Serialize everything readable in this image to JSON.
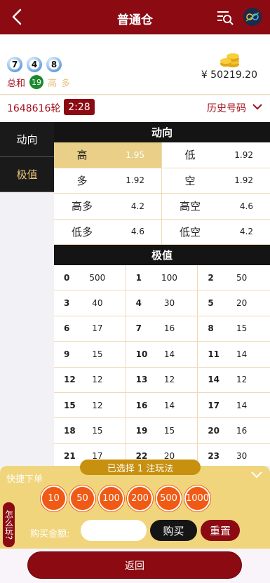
{
  "header": {
    "title": "普通仓"
  },
  "draw": {
    "balls": [
      "7",
      "4",
      "8"
    ],
    "sum_label": "总和",
    "sum_value": "19",
    "tags": [
      "高",
      "多"
    ]
  },
  "account": {
    "balance": "¥ 50219.20"
  },
  "round": {
    "label": "1648616轮",
    "timer": "2:28",
    "history_label": "历史号码"
  },
  "sidenav": {
    "items": [
      {
        "label": "动向"
      },
      {
        "label": "极值"
      }
    ]
  },
  "trend": {
    "title": "动向",
    "options": [
      {
        "name": "高",
        "odds": "1.95"
      },
      {
        "name": "低",
        "odds": "1.92"
      },
      {
        "name": "多",
        "odds": "1.92"
      },
      {
        "name": "空",
        "odds": "1.92"
      },
      {
        "name": "高多",
        "odds": "4.2"
      },
      {
        "name": "高空",
        "odds": "4.6"
      },
      {
        "name": "低多",
        "odds": "4.6"
      },
      {
        "name": "低空",
        "odds": "4.2"
      }
    ]
  },
  "extreme": {
    "title": "极值",
    "numbers": [
      {
        "n": "0",
        "v": "500"
      },
      {
        "n": "1",
        "v": "100"
      },
      {
        "n": "2",
        "v": "50"
      },
      {
        "n": "3",
        "v": "40"
      },
      {
        "n": "4",
        "v": "30"
      },
      {
        "n": "5",
        "v": "20"
      },
      {
        "n": "6",
        "v": "17"
      },
      {
        "n": "7",
        "v": "16"
      },
      {
        "n": "8",
        "v": "15"
      },
      {
        "n": "9",
        "v": "15"
      },
      {
        "n": "10",
        "v": "14"
      },
      {
        "n": "11",
        "v": "14"
      },
      {
        "n": "12",
        "v": "12"
      },
      {
        "n": "13",
        "v": "12"
      },
      {
        "n": "14",
        "v": "12"
      },
      {
        "n": "15",
        "v": "12"
      },
      {
        "n": "16",
        "v": "14"
      },
      {
        "n": "17",
        "v": "14"
      },
      {
        "n": "18",
        "v": "15"
      },
      {
        "n": "19",
        "v": "15"
      },
      {
        "n": "20",
        "v": "16"
      },
      {
        "n": "21",
        "v": "17"
      },
      {
        "n": "22",
        "v": "20"
      },
      {
        "n": "23",
        "v": "30"
      }
    ]
  },
  "quickbet": {
    "label": "快捷下单",
    "selected_text": "已选择 1 注玩法",
    "how_to_play": "怎么玩?",
    "chips": [
      "10",
      "50",
      "100",
      "200",
      "500",
      "1000"
    ],
    "amount_label": "购买金额:",
    "amount_value": "",
    "buy_label": "购买",
    "reset_label": "重置"
  },
  "bottom": {
    "return_label": "返回"
  },
  "colors": {
    "brand": "#8c0a12",
    "gold": "#e9cf87",
    "chip": "#f05a14"
  }
}
